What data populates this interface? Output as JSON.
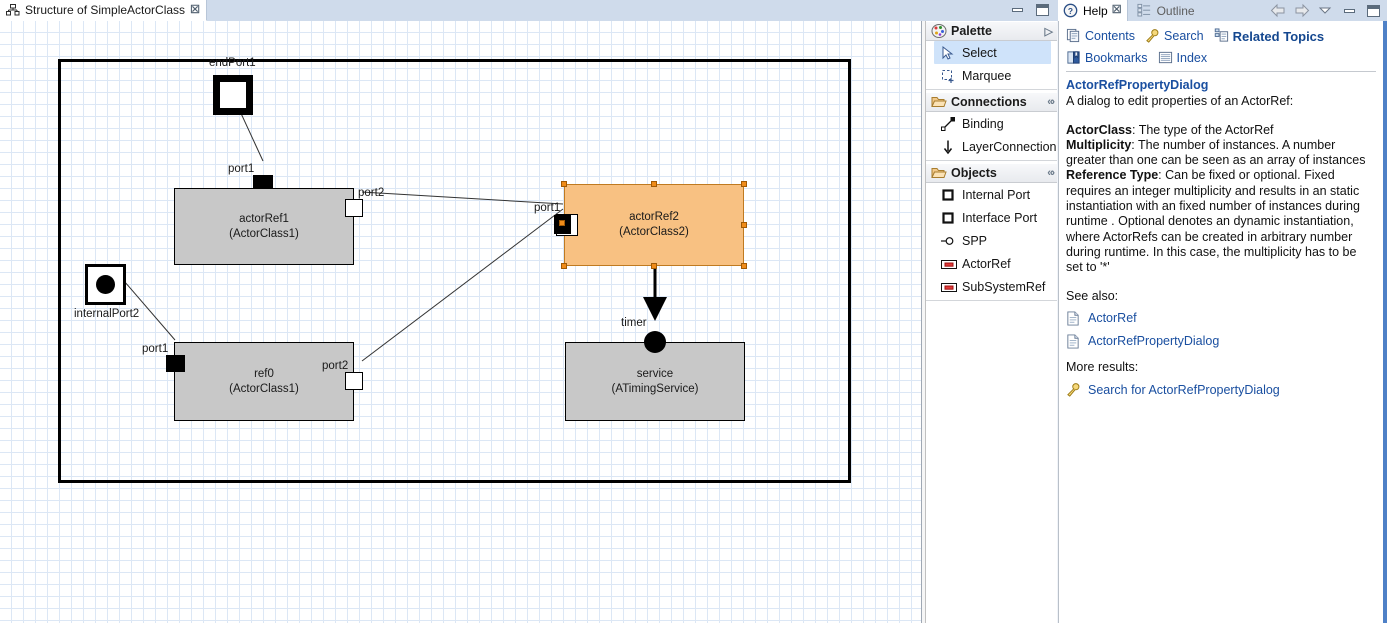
{
  "editor": {
    "tab": {
      "title": "Structure of SimpleActorClass",
      "close": "☒",
      "icon": "structure-diagram-icon"
    },
    "window_buttons": {
      "minimize": "minimize-icon",
      "maximize": "maximize-icon"
    }
  },
  "diagram": {
    "labels": {
      "endPort1": "endPort1",
      "internalPort2": "internalPort2",
      "port1_actorRef1": "port1",
      "port2_actorRef1": "port2",
      "port1_actorRef2": "port1",
      "port1_ref0": "port1",
      "port2_ref0": "port2",
      "timer": "timer"
    },
    "nodes": [
      {
        "name": "actorRef1",
        "type": "(ActorClass1)",
        "selected": false
      },
      {
        "name": "actorRef2",
        "type": "(ActorClass2)",
        "selected": true
      },
      {
        "name": "ref0",
        "type": "(ActorClass1)",
        "selected": false
      },
      {
        "name": "service",
        "type": "(ATimingService)",
        "selected": false
      }
    ],
    "colors": {
      "node_fill": "#c8c8c8",
      "selected_fill": "#f8c182",
      "selected_border": "#c07a20",
      "handle": "#f08c1a",
      "grid_line": "#dce7f5"
    }
  },
  "palette": {
    "sections": [
      {
        "title": "Palette",
        "icon": "palette-icon",
        "toggle": "chevron-right-icon",
        "entries": [
          {
            "label": "Select",
            "icon": "cursor-arrow-icon",
            "selected": true
          },
          {
            "label": "Marquee",
            "icon": "marquee-icon",
            "selected": false
          }
        ]
      },
      {
        "title": "Connections",
        "icon": "folder-open-icon",
        "toggle": "collapse-icon",
        "entries": [
          {
            "label": "Binding",
            "icon": "binding-line-icon",
            "selected": false
          },
          {
            "label": "LayerConnection",
            "icon": "down-arrow-icon",
            "selected": false
          }
        ]
      },
      {
        "title": "Objects",
        "icon": "folder-open-icon",
        "toggle": "collapse-icon",
        "entries": [
          {
            "label": "Internal Port",
            "icon": "square-port-icon",
            "selected": false
          },
          {
            "label": "Interface Port",
            "icon": "square-port-icon",
            "selected": false
          },
          {
            "label": "SPP",
            "icon": "spp-circle-icon",
            "selected": false
          },
          {
            "label": "ActorRef",
            "icon": "actorref-box-icon",
            "selected": false
          },
          {
            "label": "SubSystemRef",
            "icon": "actorref-box-icon",
            "selected": false
          }
        ]
      }
    ]
  },
  "help": {
    "tabs": [
      {
        "label": "Help",
        "icon": "help-question-icon",
        "active": true,
        "close": "☒"
      },
      {
        "label": "Outline",
        "icon": "outline-icon",
        "active": false
      }
    ],
    "window_buttons": {
      "back": "back-arrow-icon",
      "forward": "forward-arrow-icon",
      "menu": "view-menu-icon",
      "minimize": "minimize-icon",
      "maximize": "maximize-icon"
    },
    "toolbar": [
      {
        "label": "Contents",
        "icon": "contents-icon",
        "active": false
      },
      {
        "label": "Search",
        "icon": "search-key-icon",
        "active": false
      },
      {
        "label": "Related Topics",
        "icon": "related-topics-icon",
        "active": true
      },
      {
        "label": "Bookmarks",
        "icon": "bookmarks-icon",
        "active": false
      },
      {
        "label": "Index",
        "icon": "index-icon",
        "active": false
      }
    ],
    "title": "ActorRefPropertyDialog",
    "intro": "A dialog to edit properties of an ActorRef:",
    "properties": [
      {
        "term": "ActorClass",
        "desc": ": The type of the ActorRef"
      },
      {
        "term": "Multiplicity",
        "desc": ": The number of instances. A number greater than one can be seen as an array of instances"
      },
      {
        "term": "Reference Type",
        "desc": ": Can be fixed or optional. Fixed requires an integer multiplicity and results in an static instantiation with an fixed number of instances during runtime . Optional denotes an dynamic instantiation, where ActorRefs can be created in arbitrary number during runtime. In this case, the multiplicity has to be set to '*'"
      }
    ],
    "see_also_label": "See also:",
    "see_also": [
      {
        "label": "ActorRef",
        "icon": "document-icon"
      },
      {
        "label": "ActorRefPropertyDialog",
        "icon": "document-icon"
      }
    ],
    "more_results_label": "More results:",
    "more_results": [
      {
        "label": "Search for ActorRefPropertyDialog",
        "icon": "search-key-icon"
      }
    ]
  }
}
